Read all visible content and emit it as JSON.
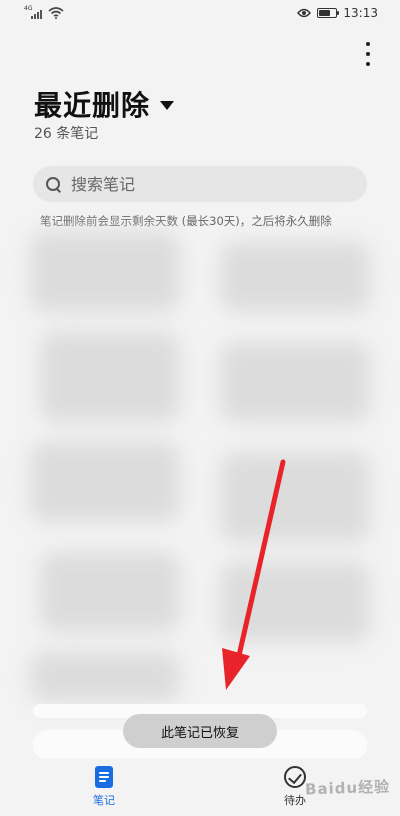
{
  "status_bar": {
    "network": "4G",
    "time": "13:13",
    "icons": [
      "signal-icon",
      "wifi-icon",
      "eye-icon",
      "battery-icon"
    ],
    "battery_level": 0.7
  },
  "header": {
    "title": "最近删除",
    "note_count": "26 条笔记"
  },
  "search": {
    "placeholder": "搜索笔记"
  },
  "hint": "笔记删除前会显示剩余天数 (最长30天)，之后将永久删除",
  "toast": "此笔记已恢复",
  "bottom_nav": {
    "items": [
      {
        "label": "笔记",
        "icon": "notes-icon",
        "active": true
      },
      {
        "label": "待办",
        "icon": "todo-icon",
        "active": false
      }
    ]
  },
  "watermark": "Baidu经验",
  "colors": {
    "accent": "#1a6de0",
    "arrow": "#e8242a",
    "background": "#f3f3f3"
  }
}
